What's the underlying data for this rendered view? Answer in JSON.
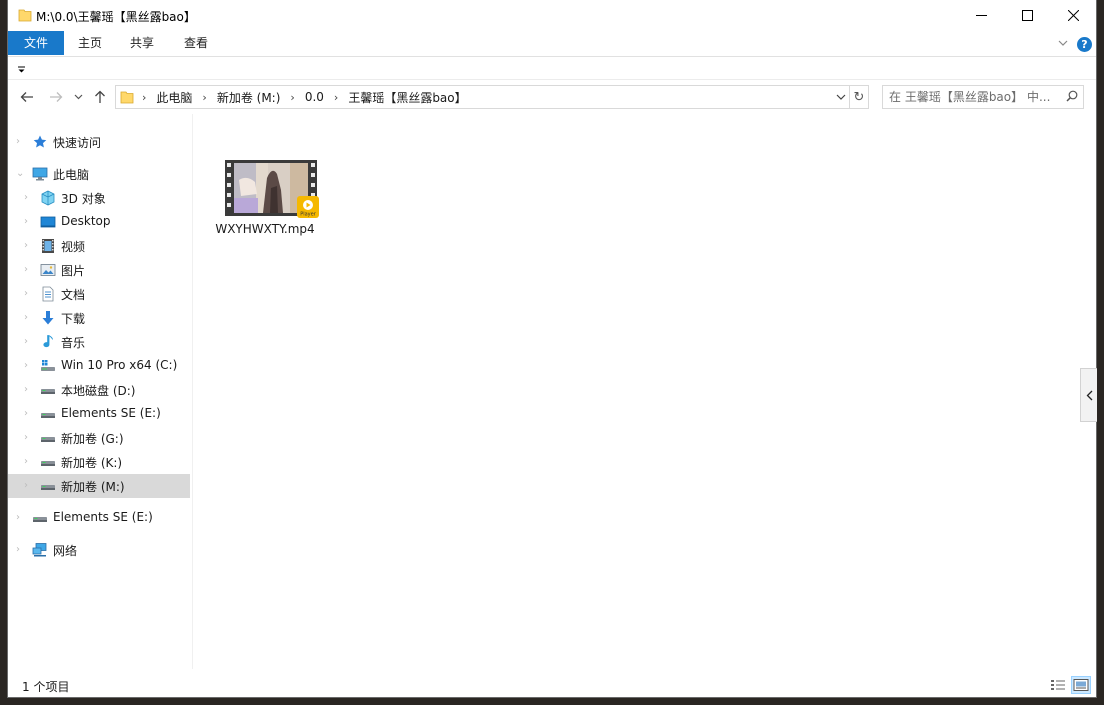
{
  "window": {
    "title": "M:\\0.0\\王馨瑶【黑丝露bao】",
    "minimize_glyph": "—",
    "maximize_glyph": "☐",
    "close_glyph": "✕"
  },
  "ribbon": {
    "tabs": [
      "文件",
      "主页",
      "共享",
      "查看"
    ],
    "expand_glyph": "﹀",
    "help_glyph": "?"
  },
  "address_bar": {
    "breadcrumbs": [
      "此电脑",
      "新加卷 (M:)",
      "0.0",
      "王馨瑶【黑丝露bao】"
    ],
    "refresh_glyph": "↻"
  },
  "search": {
    "placeholder": "在 王馨瑶【黑丝露bao】 中..."
  },
  "sidebar": {
    "items": [
      {
        "label": "快速访问",
        "icon": "star-icon"
      },
      {
        "label": "此电脑",
        "icon": "computer-icon"
      },
      {
        "label": "3D 对象",
        "icon": "cube-icon"
      },
      {
        "label": "Desktop",
        "icon": "desktop-icon"
      },
      {
        "label": "视频",
        "icon": "video-icon"
      },
      {
        "label": "图片",
        "icon": "pictures-icon"
      },
      {
        "label": "文档",
        "icon": "document-icon"
      },
      {
        "label": "下载",
        "icon": "download-icon"
      },
      {
        "label": "音乐",
        "icon": "music-icon"
      },
      {
        "label": "Win 10 Pro x64 (C:)",
        "icon": "windows-drive-icon"
      },
      {
        "label": "本地磁盘 (D:)",
        "icon": "drive-icon"
      },
      {
        "label": "Elements SE (E:)",
        "icon": "drive-icon"
      },
      {
        "label": "新加卷 (G:)",
        "icon": "drive-icon"
      },
      {
        "label": "新加卷 (K:)",
        "icon": "drive-icon"
      },
      {
        "label": "新加卷 (M:)",
        "icon": "drive-icon"
      },
      {
        "label": "Elements SE (E:)",
        "icon": "drive-icon"
      },
      {
        "label": "网络",
        "icon": "network-icon"
      }
    ]
  },
  "files": [
    {
      "name": "WXYHWXTY.mp4",
      "icon": "video-file-icon",
      "badge": "Player"
    }
  ],
  "status": {
    "item_count": "1 个项目"
  },
  "colors": {
    "accent": "#1979ca",
    "selected": "#d9d9d9",
    "folder": "#ffd86b"
  }
}
